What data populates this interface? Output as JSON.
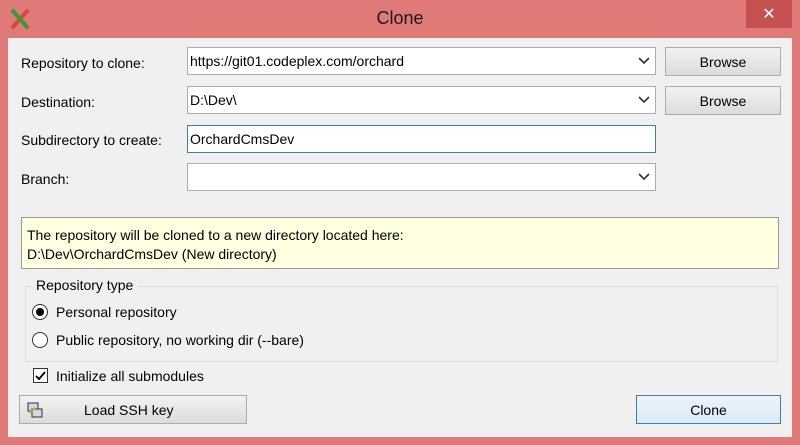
{
  "window": {
    "title": "Clone",
    "close_glyph": "✕",
    "background": "#e07a78"
  },
  "form": {
    "repo_label": "Repository to clone:",
    "repo_value": "https://git01.codeplex.com/orchard",
    "dest_label": "Destination:",
    "dest_value": "D:\\Dev\\",
    "subdir_label": "Subdirectory to create:",
    "subdir_value": "OrchardCmsDev",
    "branch_label": "Branch:",
    "branch_value": "",
    "browse_label": "Browse"
  },
  "info": {
    "line1": "The repository will be cloned to a new directory located here:",
    "line2": "D:\\Dev\\OrchardCmsDev (New directory)"
  },
  "repo_type": {
    "legend": "Repository type",
    "personal_label": "Personal repository",
    "personal_checked": true,
    "public_label": "Public repository, no working dir  (--bare)",
    "public_checked": false
  },
  "submodules": {
    "label": "Initialize all submodules",
    "checked": true
  },
  "footer": {
    "ssh_label": "Load SSH key",
    "clone_label": "Clone"
  }
}
